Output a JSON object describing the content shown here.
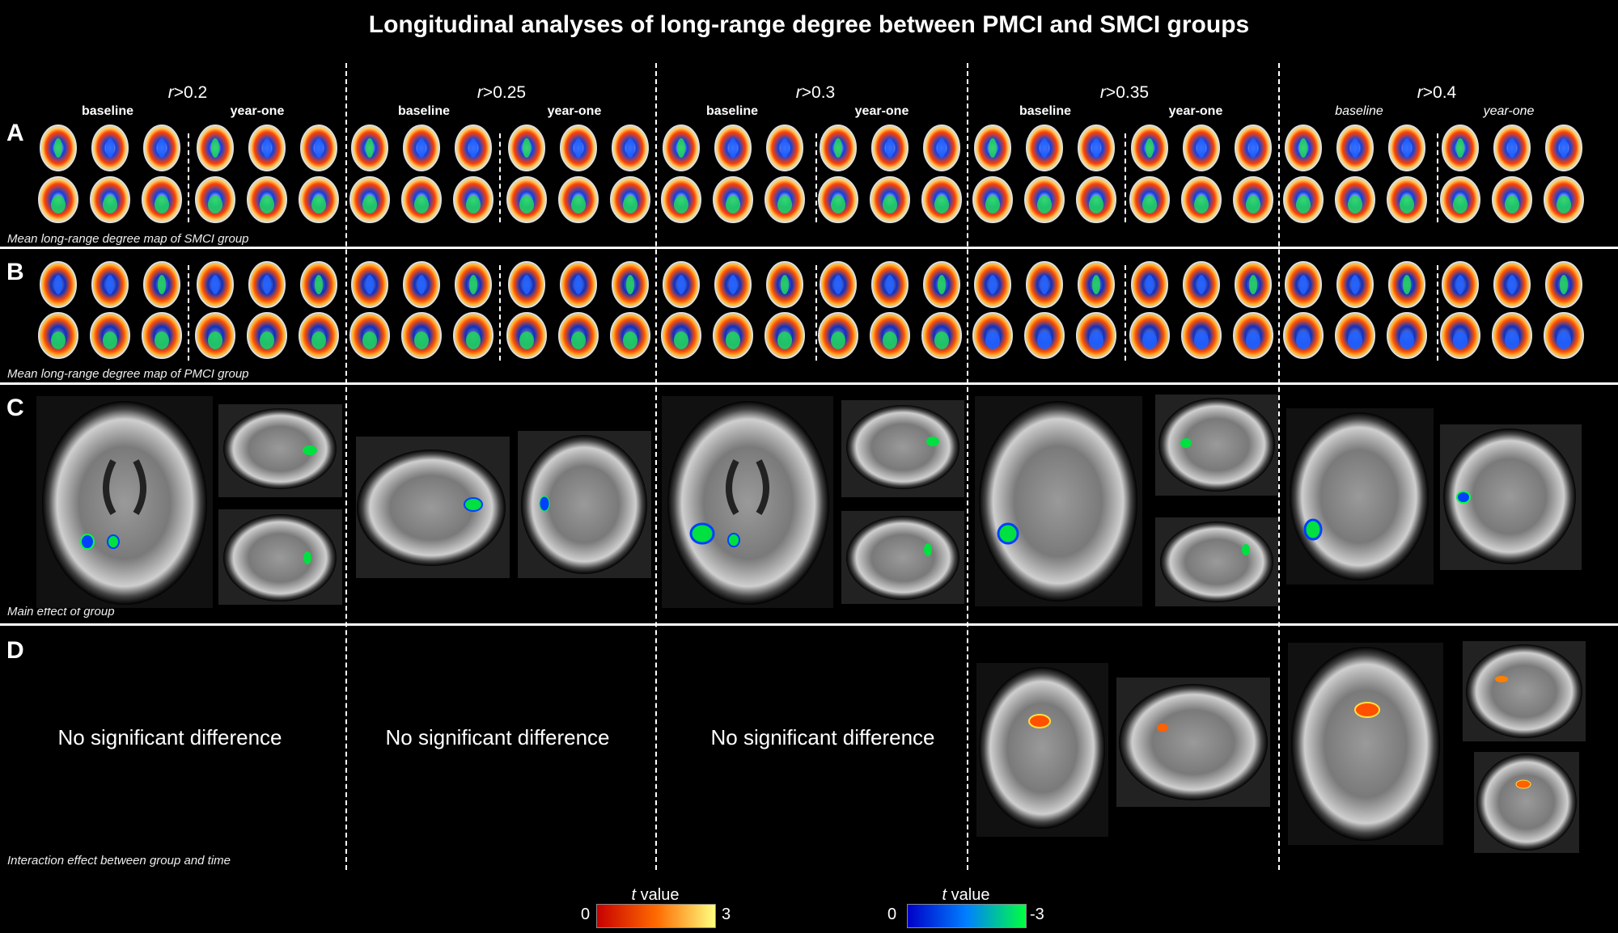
{
  "title": "Longitudinal analyses of long-range degree between PMCI and SMCI groups",
  "columns": [
    {
      "r": "r",
      "thr": ">0.2"
    },
    {
      "r": "r",
      "thr": ">0.25"
    },
    {
      "r": "r",
      "thr": ">0.3"
    },
    {
      "r": "r",
      "thr": ">0.35"
    },
    {
      "r": "r",
      "thr": ">0.4"
    }
  ],
  "sublabels": {
    "baseline": "baseline",
    "year_one": "year-one"
  },
  "panels": {
    "A": {
      "letter": "A",
      "caption": "Mean long-range degree map of SMCI group"
    },
    "B": {
      "letter": "B",
      "caption": "Mean long-range degree map of PMCI group"
    },
    "C": {
      "letter": "C",
      "caption": "Main effect of group"
    },
    "D": {
      "letter": "D",
      "caption": "Interaction effect between group and time"
    }
  },
  "no_diff": "No significant difference",
  "colorbars": {
    "positive": {
      "label_t": "t",
      "label_rest": " value",
      "min": "0",
      "max": "3",
      "colors": [
        "#c80000",
        "#ff6a00",
        "#ffff80"
      ]
    },
    "negative": {
      "label_t": "t",
      "label_rest": " value",
      "min": "0",
      "max": "-3",
      "colors": [
        "#0000c8",
        "#0080ff",
        "#00ff40"
      ]
    }
  }
}
